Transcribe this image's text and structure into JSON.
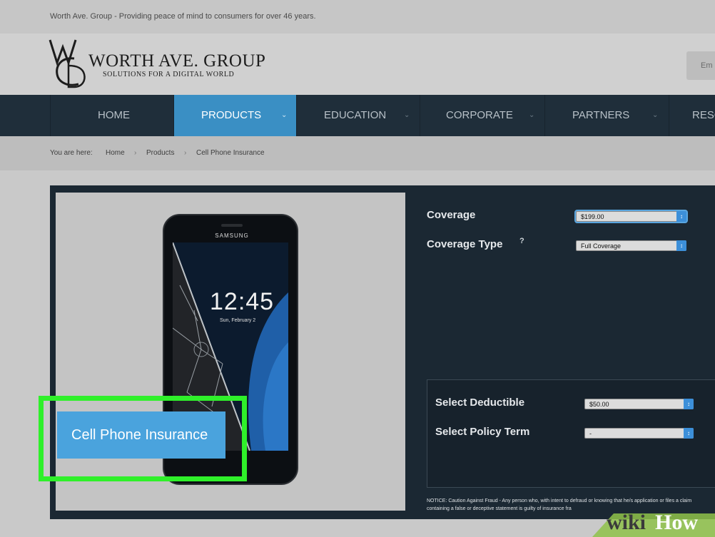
{
  "topbar": {
    "tagline": "Worth Ave. Group - Providing peace of mind to consumers for over 46 years."
  },
  "brand": {
    "name": "WORTH AVE. GROUP",
    "tagline": "SOLUTIONS FOR A DIGITAL WORLD",
    "email_label": "Em"
  },
  "nav": {
    "items": [
      {
        "label": "HOME"
      },
      {
        "label": "PRODUCTS",
        "active": true
      },
      {
        "label": "EDUCATION"
      },
      {
        "label": "CORPORATE"
      },
      {
        "label": "PARTNERS"
      },
      {
        "label": "RESO"
      }
    ]
  },
  "breadcrumb": {
    "prefix": "You are here:",
    "items": [
      "Home",
      "Products",
      "Cell Phone Insurance"
    ]
  },
  "product": {
    "caption": "Cell Phone Insurance",
    "phone": {
      "brand": "SAMSUNG",
      "time": "12:45",
      "date": "Sun, February 2"
    }
  },
  "form": {
    "coverage_label": "Coverage",
    "coverage_value": "$199.00",
    "coverage_type_label": "Coverage Type",
    "coverage_type_value": "Full Coverage",
    "help_icon": "?",
    "deductible_label": "Select Deductible",
    "deductible_value": "$50.00",
    "policy_term_label": "Select Policy Term",
    "policy_term_value": "-"
  },
  "notice": "NOTICE: Caution Against Fraud - Any person who, with intent to defraud or knowing that he/s application or files a claim containing a false or deceptive statement is guilty of insurance fra",
  "watermark": {
    "wiki": "wiki",
    "how": "How"
  },
  "colors": {
    "nav_bg": "#1f2e3a",
    "accent": "#3a8fc4",
    "highlight": "#2ff02a",
    "caption_bg": "#4aa3dd",
    "panel_bg": "#1b2833"
  }
}
